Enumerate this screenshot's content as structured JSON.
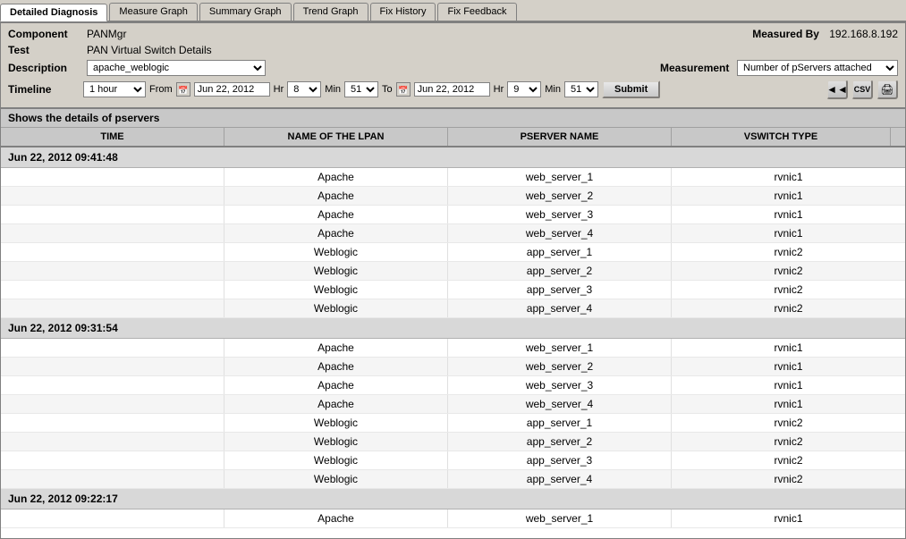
{
  "tabs": [
    {
      "label": "Detailed Diagnosis",
      "active": true
    },
    {
      "label": "Measure Graph",
      "active": false
    },
    {
      "label": "Summary Graph",
      "active": false
    },
    {
      "label": "Trend Graph",
      "active": false
    },
    {
      "label": "Fix History",
      "active": false
    },
    {
      "label": "Fix Feedback",
      "active": false
    }
  ],
  "form": {
    "component_label": "Component",
    "component_value": "PANMgr",
    "test_label": "Test",
    "test_value": "PAN Virtual Switch Details",
    "description_label": "Description",
    "description_value": "apache_weblogic",
    "timeline_label": "Timeline",
    "timeline_value": "1 hour",
    "from_label": "From",
    "from_date": "Jun 22, 2012",
    "from_hr": "8",
    "from_min": "51",
    "to_label": "To",
    "to_date": "Jun 22, 2012",
    "to_hr": "9",
    "to_min": "51",
    "hr_label": "Hr",
    "min_label": "Min",
    "submit_label": "Submit",
    "measured_by_label": "Measured By",
    "measured_by_value": "192.168.8.192",
    "measurement_label": "Measurement",
    "measurement_value": "Number of pServers attached"
  },
  "description_text": "Shows the details of pservers",
  "table": {
    "columns": [
      "TIME",
      "NAME OF THE LPAN",
      "PSERVER NAME",
      "VSWITCH TYPE"
    ],
    "groups": [
      {
        "header": "Jun 22, 2012 09:41:48",
        "rows": [
          {
            "time": "",
            "lpan": "Apache",
            "pserver": "web_server_1",
            "vswitch": "rvnic1"
          },
          {
            "time": "",
            "lpan": "Apache",
            "pserver": "web_server_2",
            "vswitch": "rvnic1"
          },
          {
            "time": "",
            "lpan": "Apache",
            "pserver": "web_server_3",
            "vswitch": "rvnic1"
          },
          {
            "time": "",
            "lpan": "Apache",
            "pserver": "web_server_4",
            "vswitch": "rvnic1"
          },
          {
            "time": "",
            "lpan": "Weblogic",
            "pserver": "app_server_1",
            "vswitch": "rvnic2"
          },
          {
            "time": "",
            "lpan": "Weblogic",
            "pserver": "app_server_2",
            "vswitch": "rvnic2"
          },
          {
            "time": "",
            "lpan": "Weblogic",
            "pserver": "app_server_3",
            "vswitch": "rvnic2"
          },
          {
            "time": "",
            "lpan": "Weblogic",
            "pserver": "app_server_4",
            "vswitch": "rvnic2"
          }
        ]
      },
      {
        "header": "Jun 22, 2012 09:31:54",
        "rows": [
          {
            "time": "",
            "lpan": "Apache",
            "pserver": "web_server_1",
            "vswitch": "rvnic1"
          },
          {
            "time": "",
            "lpan": "Apache",
            "pserver": "web_server_2",
            "vswitch": "rvnic1"
          },
          {
            "time": "",
            "lpan": "Apache",
            "pserver": "web_server_3",
            "vswitch": "rvnic1"
          },
          {
            "time": "",
            "lpan": "Apache",
            "pserver": "web_server_4",
            "vswitch": "rvnic1"
          },
          {
            "time": "",
            "lpan": "Weblogic",
            "pserver": "app_server_1",
            "vswitch": "rvnic2"
          },
          {
            "time": "",
            "lpan": "Weblogic",
            "pserver": "app_server_2",
            "vswitch": "rvnic2"
          },
          {
            "time": "",
            "lpan": "Weblogic",
            "pserver": "app_server_3",
            "vswitch": "rvnic2"
          },
          {
            "time": "",
            "lpan": "Weblogic",
            "pserver": "app_server_4",
            "vswitch": "rvnic2"
          }
        ]
      },
      {
        "header": "Jun 22, 2012 09:22:17",
        "rows": [
          {
            "time": "",
            "lpan": "Apache",
            "pserver": "web_server_1",
            "vswitch": "rvnic1"
          }
        ]
      }
    ]
  },
  "icons": {
    "prev_icon": "◄",
    "next_icon": "►",
    "calendar_icon": "📅",
    "export1_icon": "⬇",
    "export2_icon": "📊",
    "print_icon": "🖨"
  }
}
